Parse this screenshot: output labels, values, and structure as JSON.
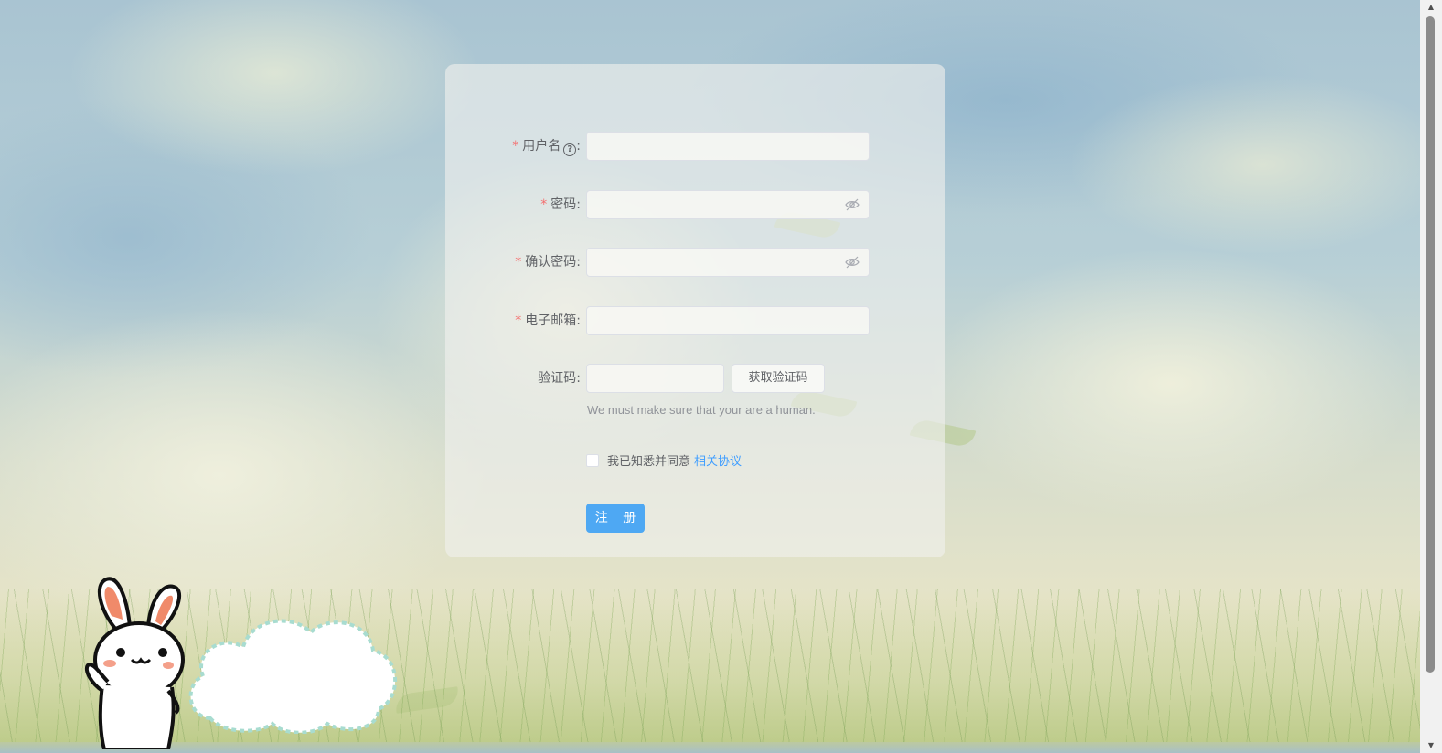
{
  "form": {
    "username": {
      "label": "用户名",
      "required": true,
      "help_icon": "question-circle-icon",
      "value": ""
    },
    "password": {
      "label": "密码",
      "required": true,
      "value": "",
      "toggle_icon": "eye-closed-icon"
    },
    "confirm_password": {
      "label": "确认密码",
      "required": true,
      "value": "",
      "toggle_icon": "eye-closed-icon"
    },
    "email": {
      "label": "电子邮箱",
      "required": true,
      "value": ""
    },
    "captcha": {
      "label": "验证码",
      "required": false,
      "value": "",
      "button_label": "获取验证码",
      "hint": "We must make sure that your are a human."
    },
    "agreement": {
      "checked": false,
      "text": "我已知悉并同意",
      "link_text": "相关协议"
    },
    "submit_label": "注 册",
    "label_suffix": ":",
    "required_mark": "*"
  },
  "colors": {
    "primary": "#4ea8f3",
    "link": "#409eff",
    "required": "#f56c6c",
    "text": "#606266",
    "hint": "#909399"
  },
  "decorations": {
    "scrollbar_up_arrow": "▲",
    "scrollbar_down_arrow": "▼"
  }
}
